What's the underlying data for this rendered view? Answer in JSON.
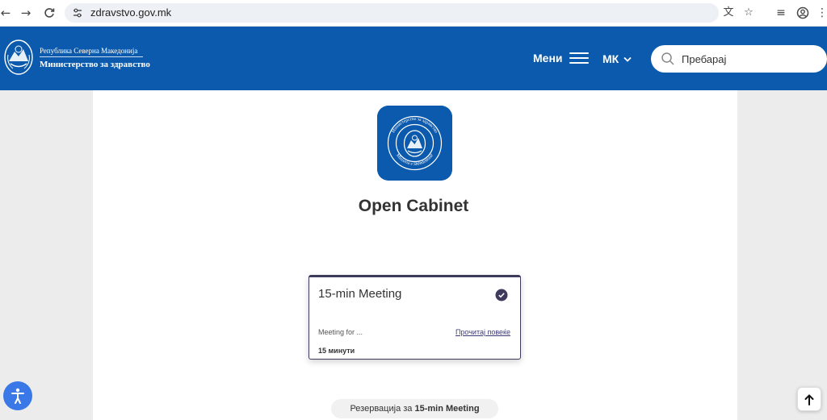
{
  "browser": {
    "url": "zdravstvo.gov.mk",
    "back_icon": "←",
    "forward_icon": "→",
    "reload_icon": "C",
    "site_info_icon": "⚙",
    "translate_icon": "文",
    "bookmark_icon": "☆",
    "media_icon": "≡",
    "profile_icon": "◉",
    "more_icon": "⋮"
  },
  "header": {
    "brand_line1": "Република Северна Македонија",
    "brand_line2": "Министерство за здравство",
    "menu_label": "Мени",
    "lang_label": "МК",
    "search_placeholder": "Пребарај",
    "brand_color": "#0b5aad"
  },
  "main": {
    "title": "Open Cabinet",
    "logo_ring_top": "Министерство за здравство",
    "logo_ring_bottom": "Ministria e Shëndetësisë",
    "card": {
      "title": "15-min Meeting",
      "description": "Meeting for ...",
      "read_more": "Прочитај повеќе",
      "duration": "15 минути"
    },
    "reserve_prefix": "Резервација за",
    "reserve_target": "15-min Meeting"
  },
  "colors": {
    "accent": "#3d3a5c",
    "a11y_button": "#3b78e7"
  }
}
